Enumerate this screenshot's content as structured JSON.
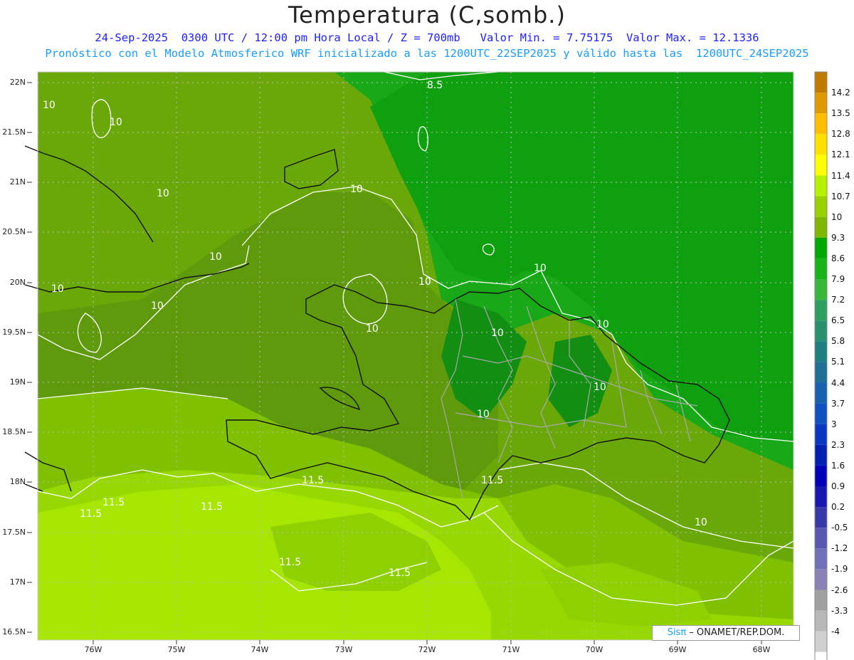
{
  "title": "Temperatura (C,somb.)",
  "subtitle_line1": "24-Sep-2025  0300 UTC / 12:00 pm Hora Local / Z = 700mb   Valor Min. = 7.75175  Valor Max. = 12.1336",
  "subtitle_line2": "Pronóstico con el Modelo Atmosferico WRF inicializado a las 1200UTC_22SEP2025 y válido hasta las  1200UTC_24SEP2025",
  "latitude_labels": [
    "22N",
    "21.5N",
    "21N",
    "20.5N",
    "20N",
    "19.5N",
    "19N",
    "18.5N",
    "18N",
    "17.5N",
    "17N",
    "16.5N"
  ],
  "longitude_labels": [
    "76W",
    "75W",
    "74W",
    "73W",
    "72W",
    "71W",
    "70W",
    "69W",
    "68W"
  ],
  "colorbar": {
    "labels": [
      "14.2",
      "13.5",
      "12.8",
      "12.1",
      "11.4",
      "10.7",
      "10",
      "9.3",
      "8.6",
      "7.9",
      "7.2",
      "6.5",
      "5.8",
      "5.1",
      "4.4",
      "3.7",
      "3",
      "2.3",
      "1.6",
      "0.9",
      "0.2",
      "-0.5",
      "-1.2",
      "-1.9",
      "-2.6",
      "-3.3",
      "-4"
    ],
    "colors": [
      "#c07a00",
      "#e09a00",
      "#ffbf00",
      "#ffe000",
      "#ffff00",
      "#b7f000",
      "#99d000",
      "#7fb800",
      "#00a800",
      "#18b418",
      "#38b838",
      "#30a060",
      "#28906e",
      "#1f7f80",
      "#1f6f96",
      "#1860b0",
      "#1050c0",
      "#0838c0",
      "#0020b0",
      "#0000b8",
      "#1818b0",
      "#3838a8",
      "#5858b0",
      "#7070b8",
      "#8c80b8",
      "#a0a0a0",
      "#b8b8b8",
      "#d0d0d0",
      "#ffffff"
    ]
  },
  "contour_labels": [
    "8.5",
    "10",
    "11.5"
  ],
  "credit": {
    "brand_prefix": "Sis",
    "brand_symbol": "π",
    "text": " – ONAMET/REP.DOM."
  }
}
